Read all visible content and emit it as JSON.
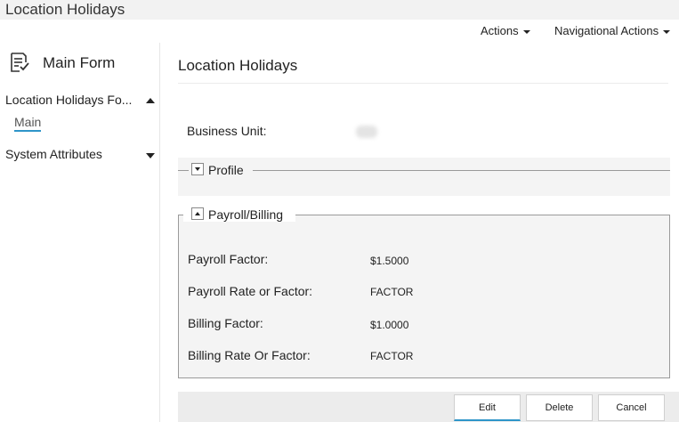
{
  "page": {
    "title": "Location Holidays"
  },
  "topbar": {
    "actions_label": "Actions",
    "nav_actions_label": "Navigational Actions"
  },
  "sidebar": {
    "form_title": "Main Form",
    "form_icon": "form-list-icon",
    "sections": [
      {
        "label": "Location Holidays Fo...",
        "expanded": true,
        "items": [
          {
            "label": "Main",
            "selected": true
          }
        ]
      },
      {
        "label": "System Attributes",
        "expanded": false,
        "items": []
      }
    ]
  },
  "main": {
    "title": "Location Holidays",
    "business_unit_label": "Business Unit:",
    "profile_legend": "Profile",
    "payroll_legend": "Payroll/Billing",
    "fields": [
      {
        "label": "Payroll Factor:",
        "value": "$1.5000"
      },
      {
        "label": "Payroll Rate or Factor:",
        "value": "FACTOR"
      },
      {
        "label": "Billing Factor:",
        "value": "$1.0000"
      },
      {
        "label": "Billing Rate Or Factor:",
        "value": "FACTOR"
      }
    ]
  },
  "buttons": {
    "edit": "Edit",
    "delete": "Delete",
    "cancel": "Cancel"
  },
  "colors": {
    "accent": "#2e95c9",
    "panel": "#f4f4f4",
    "titlebar": "#f2f2f2"
  }
}
